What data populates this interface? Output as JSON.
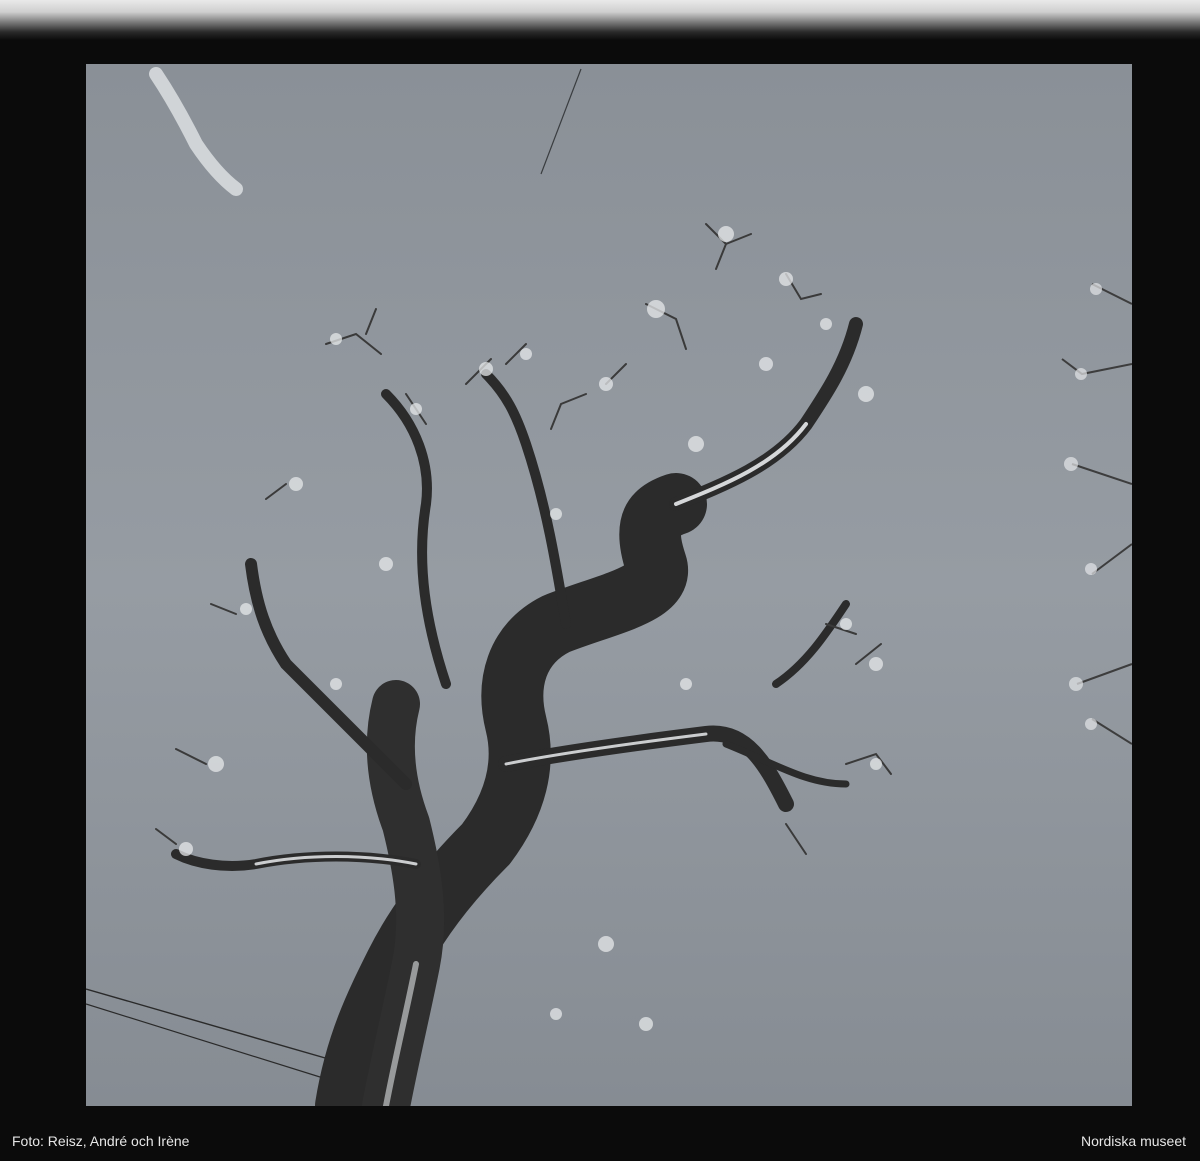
{
  "photo": {
    "subject": "tree-icon"
  },
  "credits": {
    "photographer": "Foto: Reisz, André och Irène",
    "institution": "Nordiska museet"
  },
  "colors": {
    "sky": "#8e949b",
    "bark": "#2b2b2b",
    "snow": "#e8eaec",
    "film_border": "#0b0b0b"
  }
}
